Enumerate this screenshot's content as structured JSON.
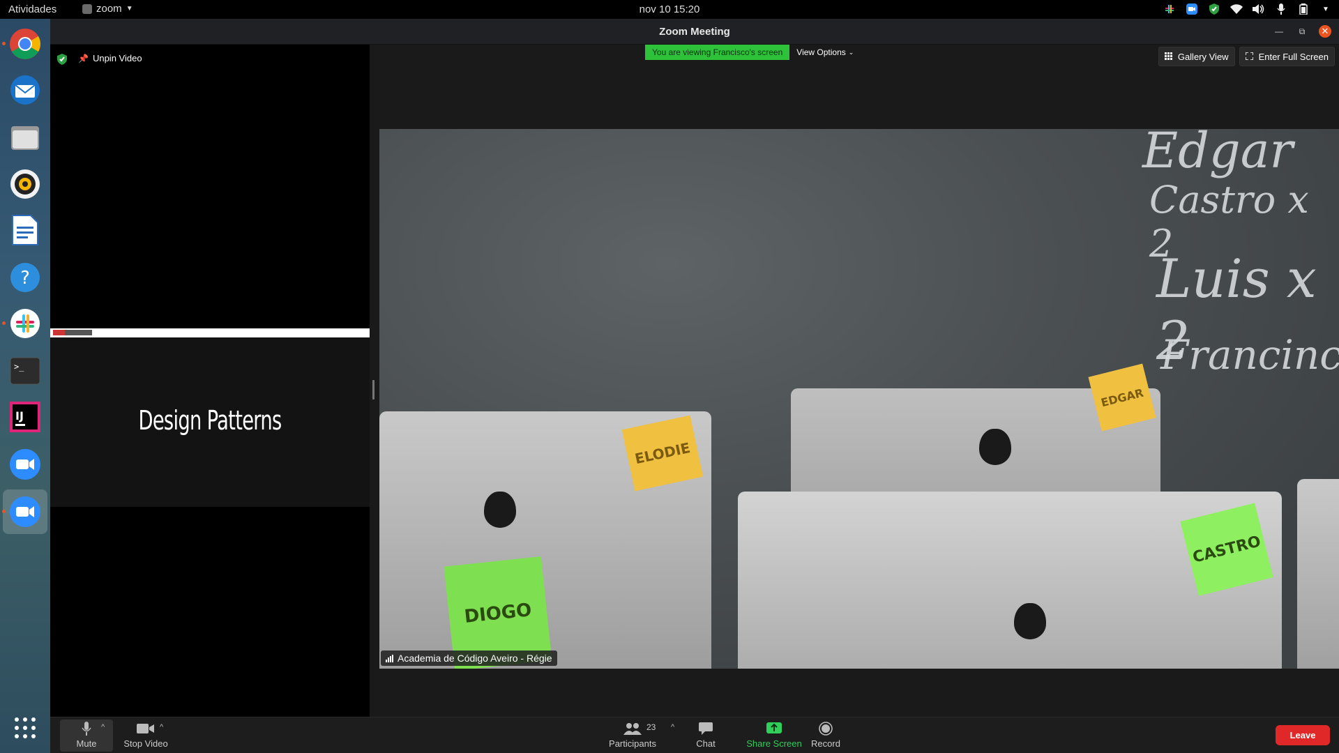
{
  "topbar": {
    "activities": "Atividades",
    "app_name": "zoom",
    "clock": "nov 10  15:20",
    "tray_icons": [
      "slack-tray-icon",
      "zoom-tray-icon",
      "shield-tray-icon",
      "wifi-icon",
      "volume-icon",
      "microphone-icon",
      "battery-icon",
      "system-menu-chevron-icon"
    ]
  },
  "dock": {
    "apps": [
      "chrome",
      "thunderbird",
      "files",
      "rhythmbox",
      "writer",
      "help",
      "slack",
      "terminal",
      "intellij",
      "zoom",
      "zoom-meeting"
    ],
    "show_apps_icon": "grid-icon"
  },
  "window": {
    "title": "Zoom Meeting"
  },
  "sidebar": {
    "unpin_label": "Unpin Video",
    "slide_title": "Design Patterns"
  },
  "viewbar": {
    "viewing_label": "You are viewing Francisco's screen",
    "view_options_label": "View Options"
  },
  "top_buttons": {
    "gallery_label": "Gallery View",
    "fullscreen_label": "Enter Full Screen"
  },
  "video": {
    "participant_label": "Academia de Código Aveiro - Régie",
    "board_names": [
      "Edgar",
      "Castro x 2",
      "Luis x 2",
      "Francinco"
    ],
    "sticky_notes": [
      "ELODIE",
      "EDGAR",
      "CASTRO",
      "DIOGO"
    ]
  },
  "toolbar": {
    "mute_label": "Mute",
    "stop_video_label": "Stop Video",
    "participants_label": "Participants",
    "participants_count": "23",
    "chat_label": "Chat",
    "share_label": "Share Screen",
    "record_label": "Record",
    "leave_label": "Leave"
  },
  "colors": {
    "share_green": "#2ed05a",
    "leave_red": "#e02828",
    "viewing_green": "#2ec23a",
    "ubuntu_orange": "#e95420"
  }
}
